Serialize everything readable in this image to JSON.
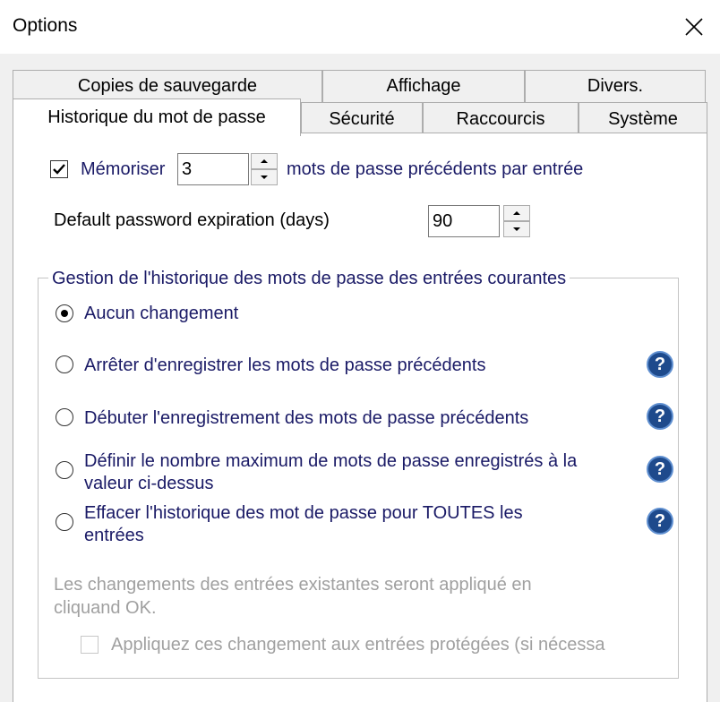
{
  "window": {
    "title": "Options",
    "close_icon": "close-icon"
  },
  "tabs": {
    "back_row": [
      "Copies de sauvegarde",
      "Affichage",
      "Divers."
    ],
    "front_row": [
      "Historique du mot de passe",
      "Sécurité",
      "Raccourcis",
      "Système"
    ],
    "active": "Historique du mot de passe"
  },
  "remember": {
    "checked": true,
    "label": "Mémoriser",
    "value": "3",
    "suffix": "mots de passe précédents par entrée"
  },
  "expiration": {
    "label": "Default password expiration (days)",
    "value": "90"
  },
  "group": {
    "title": "Gestion de l'historique des mots de passe des entrées courantes",
    "options": [
      {
        "label": "Aucun changement",
        "selected": true,
        "help": false
      },
      {
        "label": "Arrêter d'enregistrer les mots de passe précédents",
        "selected": false,
        "help": true
      },
      {
        "label": "Débuter l'enregistrement des mots de passe précédents",
        "selected": false,
        "help": true
      },
      {
        "label": "Définir le nombre maximum de mots de passe enregistrés à la valeur ci-dessus",
        "selected": false,
        "help": true
      },
      {
        "label": "Effacer l'historique des mot de passe pour TOUTES les entrées",
        "selected": false,
        "help": true
      }
    ],
    "note": "Les changements des entrées existantes seront appliqué en cliquand OK.",
    "protected_checkbox": {
      "label": "Appliquez ces changement aux entrées protégées (si nécessa",
      "checked": false,
      "disabled": true
    }
  },
  "colors": {
    "label_text": "#1a1a66",
    "disabled_text": "#a0a0a0",
    "help_icon": "#1e4a8c"
  },
  "help_symbol": "?"
}
